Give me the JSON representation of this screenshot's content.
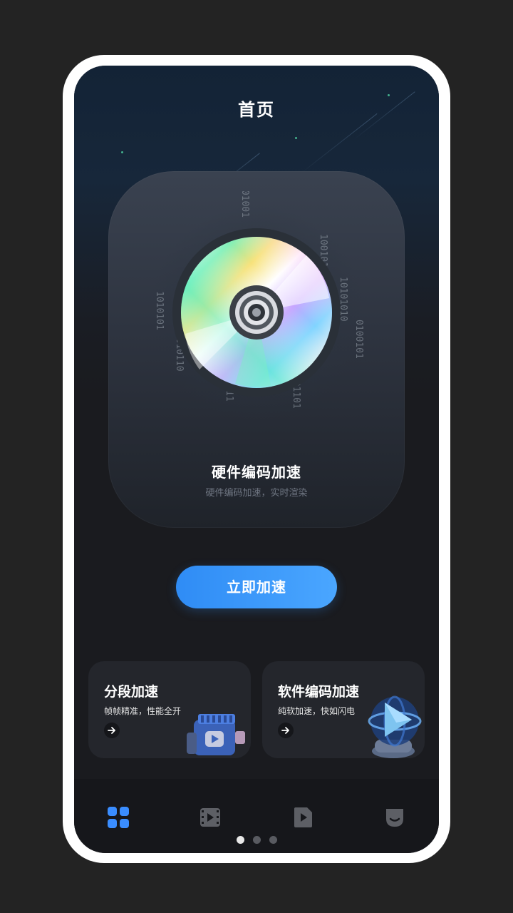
{
  "header": {
    "title": "首页"
  },
  "hero": {
    "title": "硬件编码加速",
    "subtitle": "硬件编码加速，实时渲染"
  },
  "cta": {
    "label": "立即加速"
  },
  "cards": [
    {
      "title": "分段加速",
      "subtitle": "帧帧精准，性能全开",
      "icon": "video-camera-icon"
    },
    {
      "title": "软件编码加速",
      "subtitle": "纯软加速，快如闪电",
      "icon": "play-globe-icon"
    }
  ],
  "tabs": [
    {
      "name": "home-grid-icon",
      "active": true
    },
    {
      "name": "film-icon",
      "active": false
    },
    {
      "name": "video-file-icon",
      "active": false
    },
    {
      "name": "profile-icon",
      "active": false
    }
  ],
  "pager": {
    "count": 3,
    "active": 1
  },
  "colors": {
    "accent": "#2f8cf5",
    "background": "#1a1b1f",
    "card": "#24262c",
    "tabbar": "#16171b"
  }
}
